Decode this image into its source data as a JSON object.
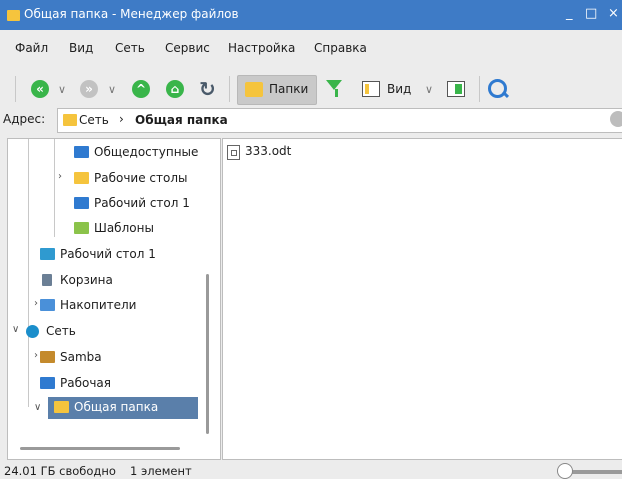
{
  "window": {
    "title": "Общая папка - Менеджер файлов",
    "minimize": "_",
    "maximize": "□",
    "close": "×"
  },
  "menu": [
    "Файл",
    "Вид",
    "Сеть",
    "Сервис",
    "Настройка",
    "Справка"
  ],
  "toolbar": {
    "back_icon": "back-arrow-icon",
    "forward_icon": "forward-arrow-icon",
    "up_icon": "up-arrow-icon",
    "home_icon": "home-icon",
    "refresh_icon": "refresh-icon",
    "folders_label": "Папки",
    "filter_icon": "filter-icon",
    "view_label": "Вид",
    "preview_icon": "preview-pane-icon",
    "search_icon": "search-icon"
  },
  "address": {
    "label": "Адрес:",
    "crumb1": "Сеть",
    "separator": "›",
    "crumb2": "Общая папка"
  },
  "tree": [
    {
      "label": "Общедоступные",
      "icon_color": "#2f7ad0"
    },
    {
      "label": "Рабочие столы",
      "icon_color": "#f5c43d"
    },
    {
      "label": "Рабочий стол 1",
      "icon_color": "#2f7ad0"
    },
    {
      "label": "Шаблоны",
      "icon_color": "#8bc34a"
    },
    {
      "label": "Рабочий стол 1",
      "icon_color": "#2f9ad0"
    },
    {
      "label": "Корзина",
      "icon_color": "#6b7f95"
    },
    {
      "label": "Накопители",
      "icon_color": "#4a90d9"
    },
    {
      "label": "Сеть",
      "icon_color": "#1a8ecb"
    },
    {
      "label": "Samba",
      "icon_color": "#c48a2c"
    },
    {
      "label": "Рабочая",
      "icon_color": "#2f7ad0"
    },
    {
      "label": "Общая папка",
      "icon_color": "#f5c43d"
    }
  ],
  "files": [
    {
      "name": "333.odt"
    }
  ],
  "status": {
    "free": "24.01 ГБ свободно",
    "count": "1 элемент"
  },
  "colors": {
    "titlebar": "#3e7bc6",
    "selection": "#5a7faa",
    "back": "#39b54a",
    "forward": "#9e9e9e"
  }
}
